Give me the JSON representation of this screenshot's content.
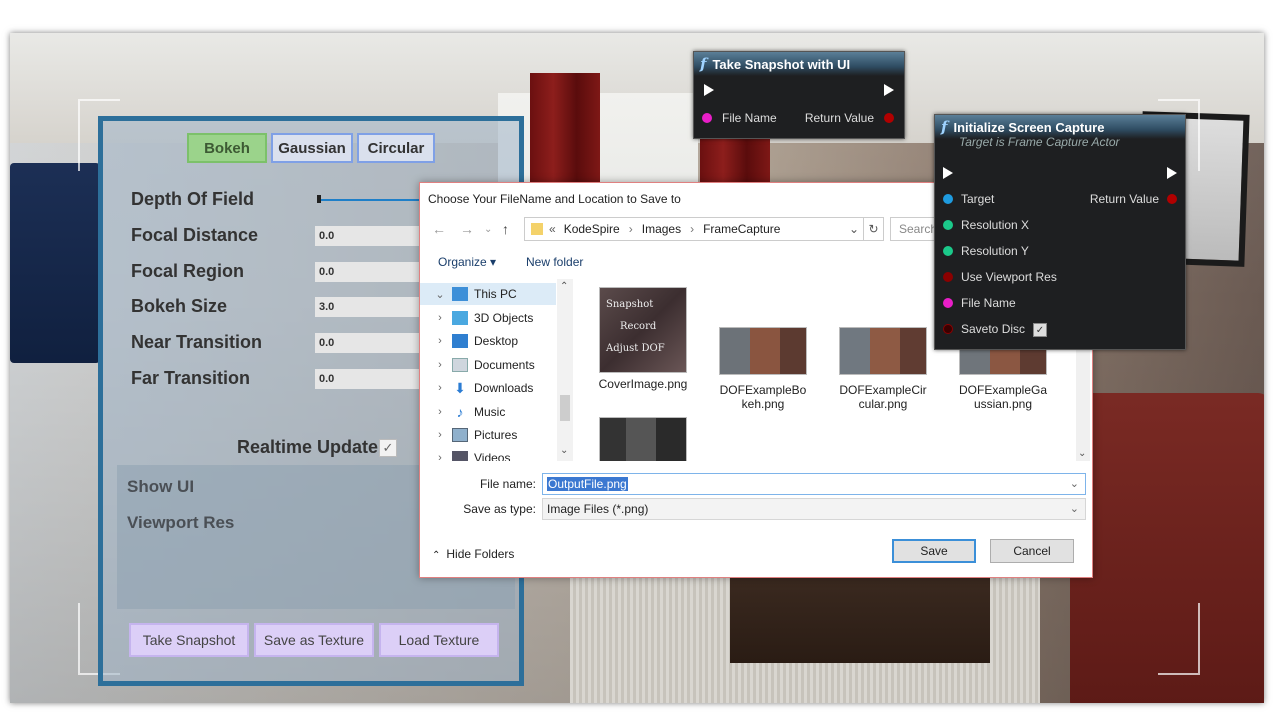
{
  "settings_panel": {
    "tabs": [
      "Bokeh",
      "Gaussian",
      "Circular"
    ],
    "active_tab": "Bokeh",
    "rows": [
      {
        "label": "Depth Of Field",
        "value": ""
      },
      {
        "label": "Focal Distance",
        "value": "0.0"
      },
      {
        "label": "Focal Region",
        "value": "0.0"
      },
      {
        "label": "Bokeh Size",
        "value": "3.0"
      },
      {
        "label": "Near Transition",
        "value": "0.0"
      },
      {
        "label": "Far Transition",
        "value": "0.0"
      }
    ],
    "realtime_update_label": "Realtime Update",
    "realtime_update_checked": true,
    "check_glyph": "✓",
    "show_ui_label": "Show UI",
    "viewport_res_label": "Viewport Res",
    "buttons": [
      "Take Snapshot",
      "Save as Texture",
      "Load Texture"
    ]
  },
  "dialog": {
    "title": "Choose Your FileName and Location to Save to",
    "path": {
      "prefix": "«",
      "parts": [
        "KodeSpire",
        "Images",
        "FrameCapture"
      ],
      "separator": "›"
    },
    "search_placeholder": "Search",
    "organize_label": "Organize ▾",
    "new_folder_label": "New folder",
    "nav_items": [
      {
        "label": "This PC",
        "icon": "computer-icon",
        "expanded": true,
        "selected": true
      },
      {
        "label": "3D Objects",
        "icon": "cube-icon"
      },
      {
        "label": "Desktop",
        "icon": "desktop-icon"
      },
      {
        "label": "Documents",
        "icon": "document-icon"
      },
      {
        "label": "Downloads",
        "icon": "download-icon"
      },
      {
        "label": "Music",
        "icon": "music-icon"
      },
      {
        "label": "Pictures",
        "icon": "pictures-icon"
      },
      {
        "label": "Videos",
        "icon": "video-icon"
      }
    ],
    "files": [
      {
        "name": "CoverImage.png",
        "thumb_text": [
          "Snapshot",
          "Record",
          "Adjust DOF"
        ]
      },
      {
        "name": "DOFExampleBokeh.png"
      },
      {
        "name": "DOFExampleCircular.png"
      },
      {
        "name": "DOFExampleGaussian.png"
      },
      {
        "name": ""
      }
    ],
    "file_name_label": "File name:",
    "file_name_value": "OutputFile.png",
    "save_type_label": "Save as type:",
    "save_type_value": "Image Files (*.png)",
    "hide_folders_label": "Hide Folders",
    "save_label": "Save",
    "cancel_label": "Cancel"
  },
  "node_snapshot": {
    "title": "Take Snapshot with UI",
    "fx": "f",
    "file_name_pin": "File Name",
    "return_value_pin": "Return Value"
  },
  "node_capture": {
    "title": "Initialize Screen Capture",
    "fx": "f",
    "subtitle": "Target is Frame Capture Actor",
    "pins": [
      {
        "label": "Target",
        "color": "#1e9be0"
      },
      {
        "label": "Resolution X",
        "color": "#1bc98a"
      },
      {
        "label": "Resolution Y",
        "color": "#1bc98a"
      },
      {
        "label": "Use Viewport Res",
        "color": "#8b0000"
      },
      {
        "label": "File Name",
        "color": "#e91ec8"
      },
      {
        "label": "Saveto Disc",
        "color": "#3a0000"
      }
    ],
    "return_value_pin": "Return Value",
    "saveto_disc_checked": true
  },
  "colors": {
    "panel_border": "#2d6f9a",
    "tab_active": "#9bd38b",
    "button_lilac": "#dccff7",
    "pin_pink": "#e91ec8",
    "pin_red": "#b10000"
  }
}
